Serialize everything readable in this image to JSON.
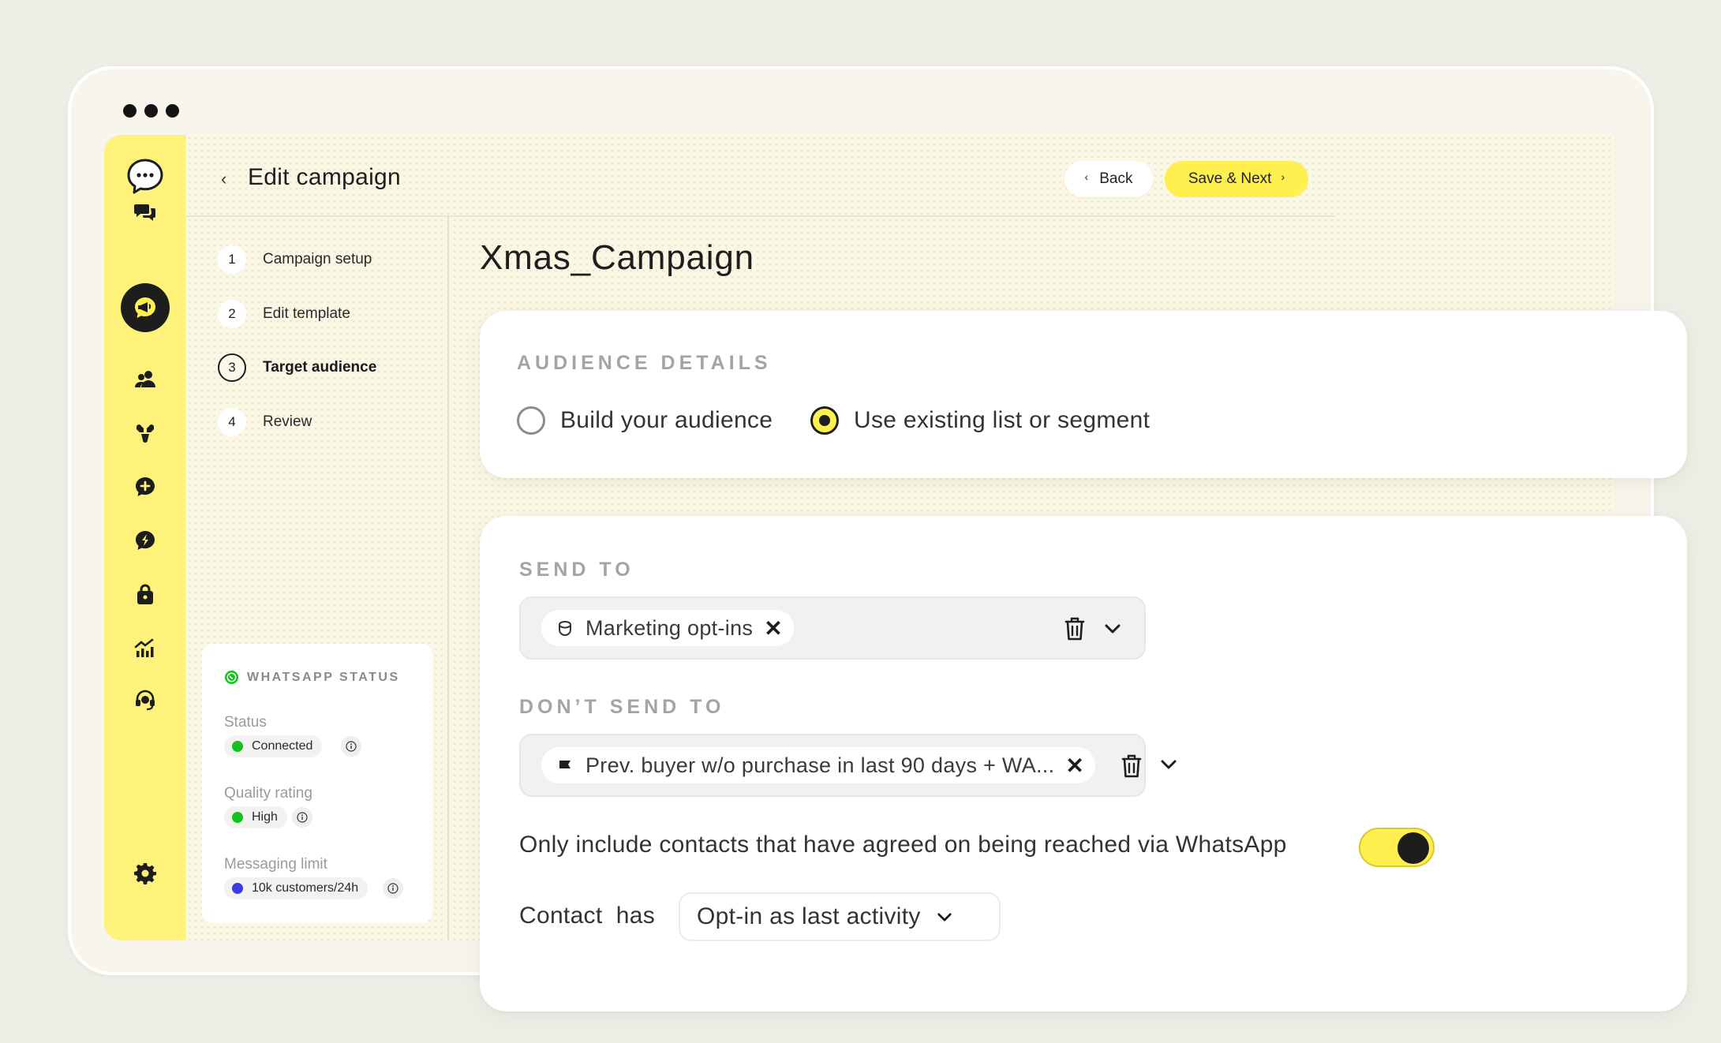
{
  "header": {
    "title": "Edit campaign",
    "back_label": "Back",
    "save_label": "Save & Next"
  },
  "steps": [
    {
      "num": "1",
      "label": "Campaign setup"
    },
    {
      "num": "2",
      "label": "Edit template"
    },
    {
      "num": "3",
      "label": "Target audience"
    },
    {
      "num": "4",
      "label": "Review"
    }
  ],
  "whatsapp_status": {
    "title": "WHATSAPP STATUS",
    "status_label": "Status",
    "status_value": "Connected",
    "quality_label": "Quality rating",
    "quality_value": "High",
    "limit_label": "Messaging limit",
    "limit_value": "10k customers/24h"
  },
  "campaign_name": "Xmas_Campaign",
  "audience": {
    "title": "AUDIENCE DETAILS",
    "option_build": "Build your audience",
    "option_existing": "Use existing list or segment",
    "selected": "existing"
  },
  "send_to": {
    "title": "SEND TO",
    "chip": "Marketing opt-ins"
  },
  "dont_send_to": {
    "title": "DON’T SEND TO",
    "chip": "Prev. buyer w/o purchase in last 90 days + WA..."
  },
  "optin_toggle": {
    "label": "Only include contacts that have agreed on being reached via WhatsApp",
    "on": true
  },
  "contact_rule": {
    "label": "Contact  has",
    "value": "Opt-in as last activity"
  },
  "colors": {
    "brand_yellow": "#fff04f",
    "status_green": "#14c21e",
    "limit_blue": "#3b3be0"
  }
}
